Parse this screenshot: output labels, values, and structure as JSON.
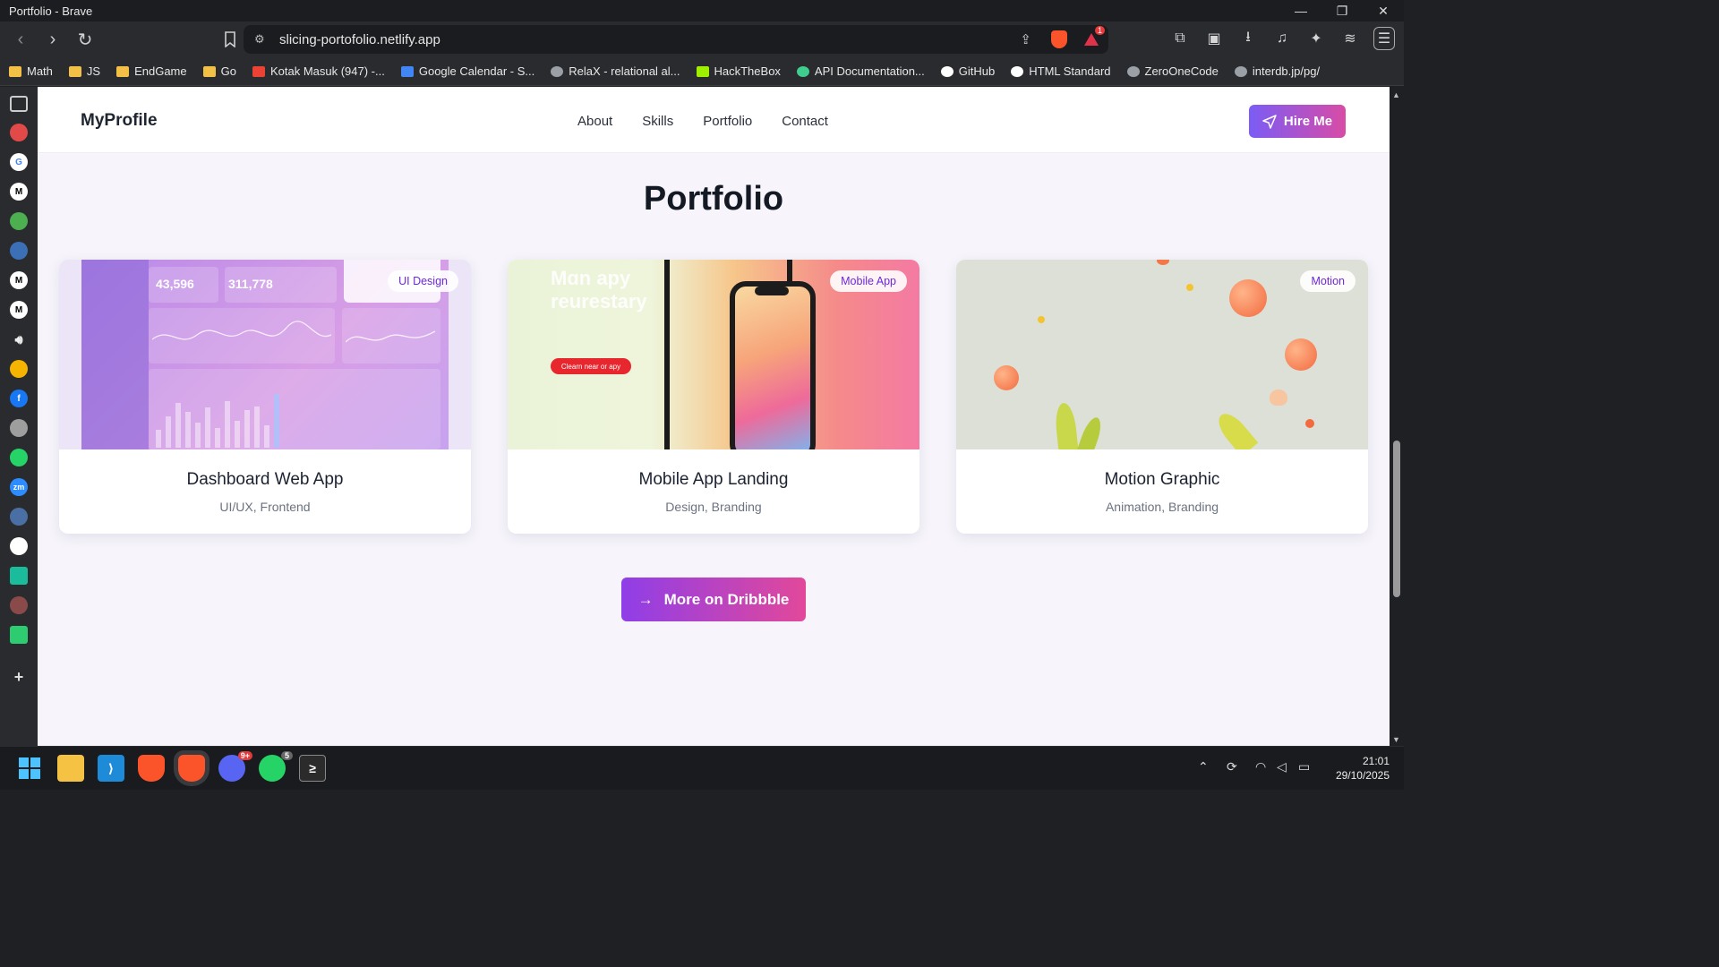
{
  "window": {
    "title": "Portfolio - Brave",
    "minimize": "—",
    "restore": "❐",
    "close": "✕"
  },
  "toolbar": {
    "url": "slicing-portofolio.netlify.app",
    "alert_count": "1"
  },
  "bookmarks": [
    {
      "label": "Math",
      "icon": "folder-icon"
    },
    {
      "label": "JS",
      "icon": "folder-icon"
    },
    {
      "label": "EndGame",
      "icon": "folder-icon"
    },
    {
      "label": "Go",
      "icon": "folder-icon"
    },
    {
      "label": "Kotak Masuk (947) -...",
      "icon": "gmail-icon"
    },
    {
      "label": "Google Calendar - S...",
      "icon": "calendar-icon"
    },
    {
      "label": "RelaX - relational al...",
      "icon": "globe-icon"
    },
    {
      "label": "HackTheBox",
      "icon": "hackthebox-icon"
    },
    {
      "label": "API Documentation...",
      "icon": "api-icon"
    },
    {
      "label": "GitHub",
      "icon": "github-icon"
    },
    {
      "label": "HTML Standard",
      "icon": "html-icon"
    },
    {
      "label": "ZeroOneCode",
      "icon": "globe-icon"
    },
    {
      "label": "interdb.jp/pg/",
      "icon": "globe-icon"
    }
  ],
  "site": {
    "logo": "MyProfile",
    "nav": [
      "About",
      "Skills",
      "Portfolio",
      "Contact"
    ],
    "hire_label": "Hire Me",
    "section_title": "Portfolio",
    "cards": [
      {
        "title": "Dashboard Web App",
        "subtitle": "UI/UX, Frontend",
        "tag": "UI Design",
        "stat1": "43,596",
        "stat2": "311,778"
      },
      {
        "title": "Mobile App Landing",
        "subtitle": "Design, Branding",
        "tag": "Mobile App",
        "hero1": "Mɑn apy",
        "hero2": "reurestary",
        "cta": "Clearn near or apy"
      },
      {
        "title": "Motion Graphic",
        "subtitle": "Animation, Branding",
        "tag": "Motion"
      }
    ],
    "more_label": "More on Dribbble"
  },
  "taskbar": {
    "time": "21:01",
    "date": "29/10/2025",
    "discord_badge": "9+",
    "whatsapp_badge": "5"
  }
}
